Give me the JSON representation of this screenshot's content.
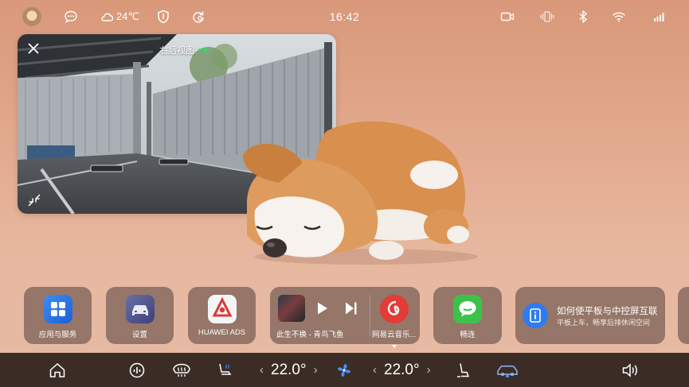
{
  "status_bar": {
    "weather": "24℃",
    "time": "16:42"
  },
  "camera": {
    "title": "右后视图"
  },
  "cards": {
    "apps": {
      "label": "应用与服务"
    },
    "settings": {
      "label": "设置"
    },
    "ads": {
      "label": "HUAWEI ADS"
    },
    "media": {
      "song": "此生不换 - 青鸟飞鱼",
      "app": "网易云音乐..."
    },
    "connect": {
      "label": "畅连"
    },
    "info": {
      "title": "如何使平板与中控屏互联",
      "subtitle": "平板上车，畅享后排休闲空间"
    }
  },
  "dock": {
    "left_temp": "22.0°",
    "right_temp": "22.0°"
  },
  "colors": {
    "wallpaper": "#e2a98d",
    "dock": "#3b2d25",
    "card": "#765c52",
    "accent_blue": "#2f7bf2",
    "wechat_green": "#3cc24a",
    "netease_red": "#e33b35"
  },
  "icons": [
    "avatar",
    "chat-bubble-icon",
    "cloud-icon",
    "shield-icon",
    "sync-icon",
    "dashcam-icon",
    "vibrate-icon",
    "bluetooth-icon",
    "wifi-icon",
    "signal-icon",
    "close-icon",
    "shrink-icon",
    "home-icon",
    "energy-icon",
    "rear-defrost-icon",
    "seat-heat-icon",
    "fan-icon",
    "seat-icon",
    "car-icon",
    "volume-icon"
  ]
}
